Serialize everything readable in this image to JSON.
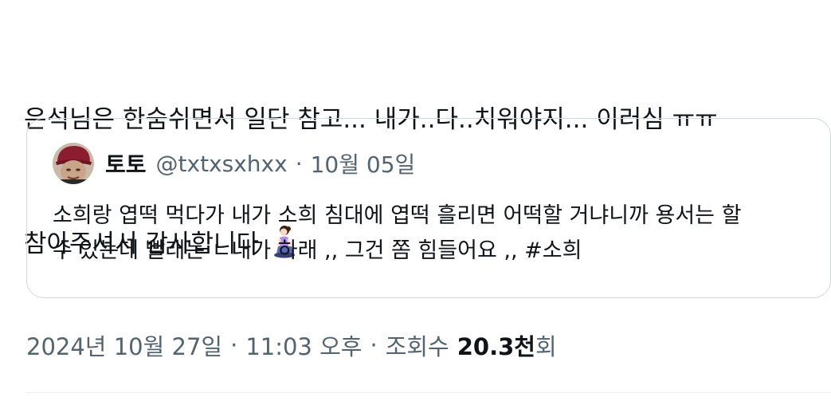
{
  "tweet": {
    "text_line1": "은석님은 한숨쉬면서 일단 참고... 내가..다..치워야지... 이러심 ㅠㅠ",
    "text_line2": "참아주셔서 감사합니다 ",
    "emoji": "person-kneeling-icon"
  },
  "quote": {
    "author_name": "토토",
    "author_handle": "@txtxsxhxx",
    "separator": "·",
    "date": "10월 05일",
    "text_line1": "소희랑 엽떡 먹다가 내가 소희 침대에 엽떡 흘리면 어떡할 거냐니까 용서는 할",
    "text_line2": "수 있는데 빨래는 ㄴ내가 하래 ,, 그건 쫌 힘들어요 ,, #소희"
  },
  "meta": {
    "date": "2024년 10월 27일",
    "separator": "·",
    "time": "11:03 오후",
    "views_label": "조회수",
    "views_count": "20.3천",
    "views_suffix": "회"
  },
  "colors": {
    "text_primary": "#0f1419",
    "text_secondary": "#536471",
    "border": "#cfd9de"
  }
}
